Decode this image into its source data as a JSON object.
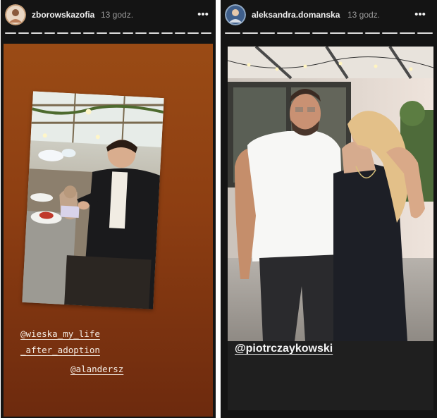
{
  "stories": [
    {
      "username": "zborowskazofia",
      "timestamp": "13 godz.",
      "more_icon": "more-dots-icon",
      "progress_segments": 16,
      "background_colors": [
        "#9a4b15",
        "#6d2a0e"
      ],
      "mentions": [
        "@wieska_my_life",
        "_after_adoption",
        "@alandersz"
      ]
    },
    {
      "username": "aleksandra.domanska",
      "timestamp": "13 godz.",
      "more_icon": "more-dots-icon",
      "progress_segments": 12,
      "mention": "@piotrczaykowski"
    }
  ]
}
